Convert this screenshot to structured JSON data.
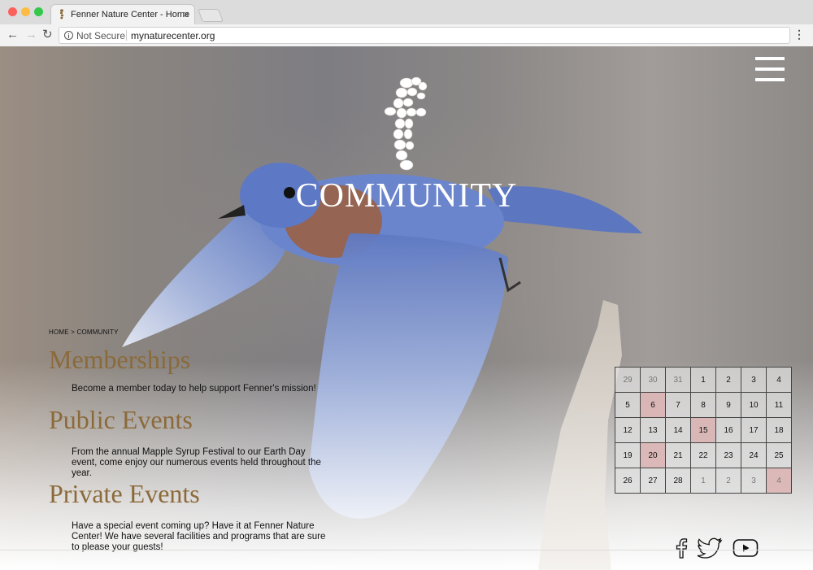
{
  "browser": {
    "tab_title": "Fenner Nature Center - Home",
    "tab_close": "×",
    "security_label": "Not Secure",
    "url": "mynaturecenter.org",
    "back_glyph": "←",
    "forward_glyph": "→",
    "reload_glyph": "↻",
    "menu_glyph": "⋮",
    "info_glyph": "i",
    "dot_colors": [
      "#fc605b",
      "#fdbc40",
      "#34c84a"
    ]
  },
  "header": {
    "title": "COMMUNITY",
    "menu_icon": "hamburger-icon",
    "logo_icon": "fenner-stone-logo"
  },
  "breadcrumb": "HOME > COMMUNITY",
  "sections": [
    {
      "heading": "Memberships",
      "text": "Become a member today to help support Fenner's mission!"
    },
    {
      "heading": "Public Events",
      "text": "From the annual Mapple Syrup Festival to our Earth Day event, come enjoy our numerous events held throughout the year."
    },
    {
      "heading": "Private Events",
      "text": "Have a special event coming up? Have it at Fenner Nature Center! We have several facilities and programs that are sure to please your guests!"
    }
  ],
  "calendar": {
    "weeks": [
      [
        "29",
        "30",
        "31",
        "1",
        "2",
        "3",
        "4"
      ],
      [
        "5",
        "6",
        "7",
        "8",
        "9",
        "10",
        "11"
      ],
      [
        "12",
        "13",
        "14",
        "15",
        "16",
        "17",
        "18"
      ],
      [
        "19",
        "20",
        "21",
        "22",
        "23",
        "24",
        "25"
      ],
      [
        "26",
        "27",
        "28",
        "1",
        "2",
        "3",
        "4"
      ]
    ],
    "highlighted": [
      "6",
      "15",
      "20"
    ],
    "highlight_color": "#dcaaaa"
  },
  "social": [
    "facebook-icon",
    "twitter-icon",
    "youtube-icon"
  ],
  "colors": {
    "heading": "#8b6a3a",
    "title": "#ffffff"
  }
}
